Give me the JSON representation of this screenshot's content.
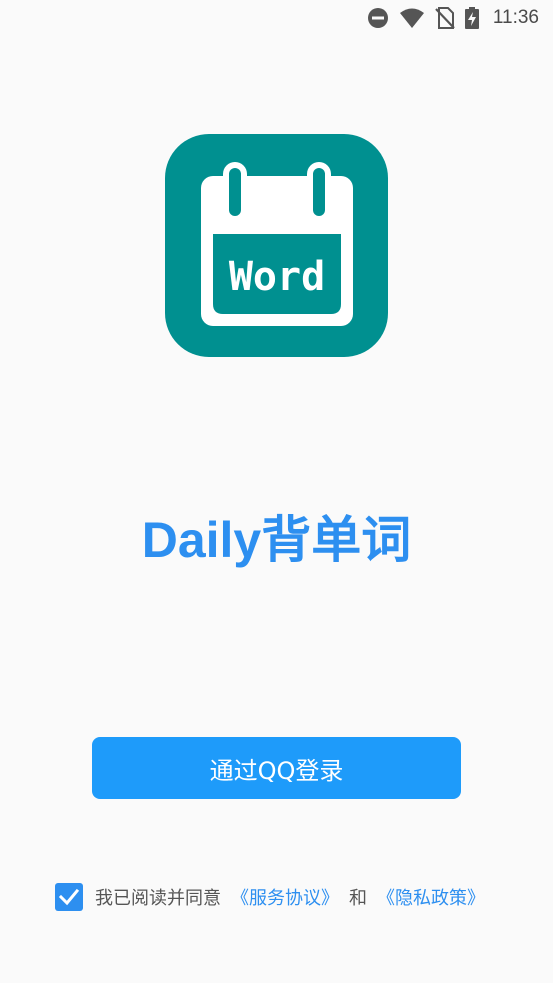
{
  "status_bar": {
    "time": "11:36",
    "icons": [
      "do-not-disturb-icon",
      "wifi-icon",
      "no-sim-icon",
      "battery-charging-icon"
    ]
  },
  "logo": {
    "text": "Word",
    "color": "#009090"
  },
  "app_title": "Daily背单词",
  "login_button": {
    "label": "通过QQ登录",
    "color": "#1e9bfa"
  },
  "agreement": {
    "checked": true,
    "prefix": "我已阅读并同意",
    "terms_link": "《服务协议》",
    "conjunction": "和",
    "privacy_link": "《隐私政策》",
    "accent": "#2d8ff0"
  }
}
